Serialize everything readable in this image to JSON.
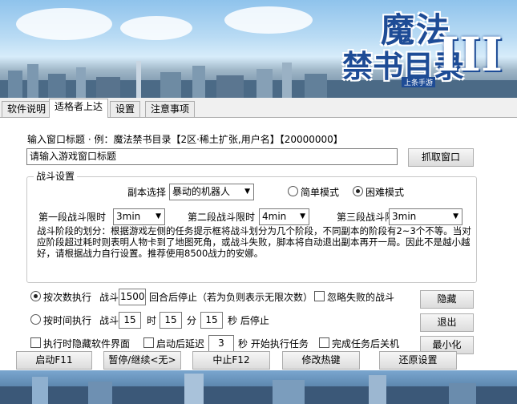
{
  "banner": {
    "logo_line1": "魔法",
    "logo_line2": "禁书目录",
    "logo_roman": "III",
    "logo_sub": "上条手游"
  },
  "tabs": [
    {
      "label": "软件说明",
      "active": false
    },
    {
      "label": "适格者上达",
      "active": true
    },
    {
      "label": "设置",
      "active": false
    },
    {
      "label": "注意事项",
      "active": false
    }
  ],
  "window_title": {
    "hint": "输入窗口标题 · 例：魔法禁书目录【2区·稀土扩张,用户名】【20000000】",
    "placeholder": "请输入游戏窗口标题",
    "grab_button": "抓取窗口"
  },
  "battle": {
    "group_title": "战斗设置",
    "instance_label": "副本选择",
    "instance_value": "暴动的机器人",
    "mode_easy": "简单模式",
    "mode_hard": "困难模式",
    "mode_selected": "hard",
    "stage1_label": "第一段战斗限时",
    "stage1_value": "3min",
    "stage2_label": "第二段战斗限时",
    "stage2_value": "4min",
    "stage3_label": "第三段战斗限时",
    "stage3_value": "3min",
    "note": "战斗阶段的划分：根据游戏左侧的任务提示框将战斗划分为几个阶段，不同副本的阶段有2~3个不等。当对应阶段超过耗时则表明人物卡到了地图死角，或战斗失败，脚本将自动退出副本再开一局。因此不是越小越好，请根据战力自行设置。推荐使用8500战力的安娜。"
  },
  "count_mode": {
    "label": "按次数执行",
    "selected": true,
    "battle_label": "战斗",
    "battle_count": "1500",
    "suffix": "回合后停止（若为负则表示无限次数）",
    "ignore_failed": "忽略失败的战斗"
  },
  "time_mode": {
    "label": "按时间执行",
    "selected": false,
    "battle_label": "战斗",
    "hours": "15",
    "hour_unit": "时",
    "minutes": "15",
    "minute_unit": "分",
    "seconds": "15",
    "second_unit": "秒 后停止"
  },
  "options": {
    "hide_ui": "执行时隐藏软件界面",
    "delay_label": "启动后延迟",
    "delay_value": "3",
    "delay_suffix": "秒 开始执行任务",
    "shutdown": "完成任务后关机"
  },
  "side_buttons": {
    "hide": "隐藏",
    "exit": "退出",
    "minimize": "最小化"
  },
  "bottom_buttons": {
    "start": "启动F11",
    "pause": "暂停/继续<无>",
    "stop": "中止F12",
    "hotkey": "修改热键",
    "reset": "还原设置"
  }
}
